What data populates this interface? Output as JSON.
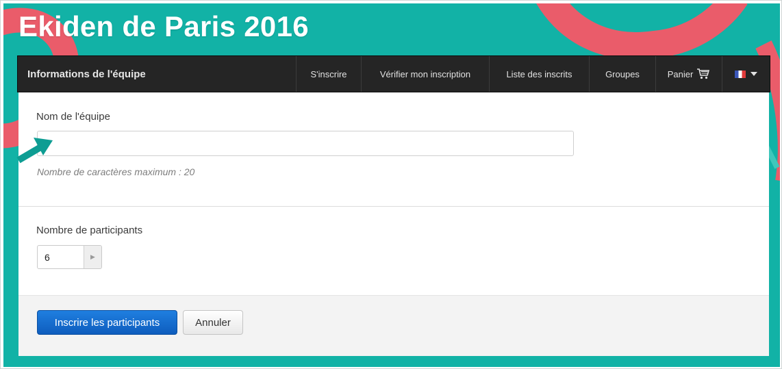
{
  "page": {
    "title": "Ekiden de Paris 2016"
  },
  "navbar": {
    "brand": "Informations de l'équipe",
    "items": [
      {
        "label": "S'inscrire"
      },
      {
        "label": "Vérifier mon inscription"
      },
      {
        "label": "Liste des inscrits"
      },
      {
        "label": "Groupes"
      },
      {
        "label": "Panier",
        "icon": "cart-icon"
      }
    ],
    "language": {
      "icon": "french-flag-icon",
      "dropdown_icon": "caret-down-icon"
    }
  },
  "form": {
    "team_name": {
      "label": "Nom de l'équipe",
      "value": "",
      "help": "Nombre de caractères maximum : 20"
    },
    "participants": {
      "label": "Nombre de participants",
      "value": "6"
    },
    "actions": {
      "submit_label": "Inscrire les participants",
      "cancel_label": "Annuler"
    }
  },
  "colors": {
    "background_teal": "#12b2a6",
    "background_pink": "#ea5c6a",
    "navbar": "#252525",
    "primary_button": "#1a72d4",
    "arrow": "#0e9d93"
  },
  "annotation": {
    "icon": "arrow-pointer-icon"
  }
}
